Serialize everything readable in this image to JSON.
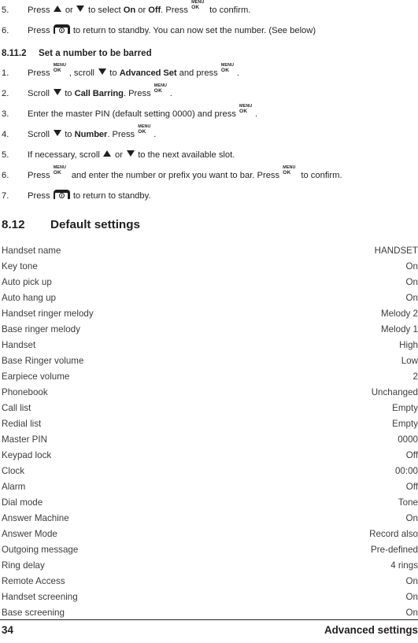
{
  "document": {
    "page_number": "34",
    "running_head": "Advanced settings"
  },
  "continued_steps": {
    "items": [
      {
        "num": "5.",
        "parts": [
          {
            "t": "text",
            "v": "Press "
          },
          {
            "t": "icon",
            "v": "triangle-up"
          },
          {
            "t": "text",
            "v": " or "
          },
          {
            "t": "icon",
            "v": "triangle-down"
          },
          {
            "t": "text",
            "v": " to select "
          },
          {
            "t": "emph",
            "v": "On"
          },
          {
            "t": "text",
            "v": " or "
          },
          {
            "t": "emph",
            "v": "Off"
          },
          {
            "t": "text",
            "v": ". Press "
          },
          {
            "t": "icon",
            "v": "menu-ok-key"
          },
          {
            "t": "text",
            "v": " to confirm."
          }
        ]
      },
      {
        "num": "6.",
        "parts": [
          {
            "t": "text",
            "v": "Press "
          },
          {
            "t": "icon",
            "v": "power-standby-key"
          },
          {
            "t": "text",
            "v": " to return to standby. You can now set the number. (See below)"
          }
        ]
      }
    ]
  },
  "section_8_11_2": {
    "number": "8.11.2",
    "title": "Set a number to be barred",
    "steps": [
      {
        "num": "1.",
        "parts": [
          {
            "t": "text",
            "v": "Press "
          },
          {
            "t": "icon",
            "v": "menu-ok-key"
          },
          {
            "t": "text",
            "v": ", scroll "
          },
          {
            "t": "icon",
            "v": "triangle-down"
          },
          {
            "t": "text",
            "v": " to "
          },
          {
            "t": "emph",
            "v": "Advanced Set"
          },
          {
            "t": "text",
            "v": " and press "
          },
          {
            "t": "icon",
            "v": "menu-ok-key"
          },
          {
            "t": "text",
            "v": "."
          }
        ]
      },
      {
        "num": "2.",
        "parts": [
          {
            "t": "text",
            "v": "Scroll "
          },
          {
            "t": "icon",
            "v": "triangle-down"
          },
          {
            "t": "text",
            "v": " to "
          },
          {
            "t": "emph",
            "v": "Call Barring"
          },
          {
            "t": "text",
            "v": ". Press "
          },
          {
            "t": "icon",
            "v": "menu-ok-key"
          },
          {
            "t": "text",
            "v": "."
          }
        ]
      },
      {
        "num": "3.",
        "parts": [
          {
            "t": "text",
            "v": "Enter the master PIN (default setting 0000) and press "
          },
          {
            "t": "icon",
            "v": "menu-ok-key"
          },
          {
            "t": "text",
            "v": "."
          }
        ]
      },
      {
        "num": "4.",
        "parts": [
          {
            "t": "text",
            "v": "Scroll "
          },
          {
            "t": "icon",
            "v": "triangle-down"
          },
          {
            "t": "text",
            "v": " to "
          },
          {
            "t": "emph",
            "v": "Number"
          },
          {
            "t": "text",
            "v": ". Press "
          },
          {
            "t": "icon",
            "v": "menu-ok-key"
          },
          {
            "t": "text",
            "v": "."
          }
        ]
      },
      {
        "num": "5.",
        "parts": [
          {
            "t": "text",
            "v": "If necessary, scroll "
          },
          {
            "t": "icon",
            "v": "triangle-up"
          },
          {
            "t": "text",
            "v": " or "
          },
          {
            "t": "icon",
            "v": "triangle-down"
          },
          {
            "t": "text",
            "v": " to the next available slot."
          }
        ]
      },
      {
        "num": "6.",
        "parts": [
          {
            "t": "text",
            "v": "Press "
          },
          {
            "t": "icon",
            "v": "menu-ok-key"
          },
          {
            "t": "text",
            "v": " and enter the number or prefix you want to bar. Press "
          },
          {
            "t": "icon",
            "v": "menu-ok-key"
          },
          {
            "t": "text",
            "v": " to confirm."
          }
        ]
      },
      {
        "num": "7.",
        "parts": [
          {
            "t": "text",
            "v": "Press "
          },
          {
            "t": "icon",
            "v": "power-standby-key"
          },
          {
            "t": "text",
            "v": " to return to standby."
          }
        ]
      }
    ]
  },
  "section_8_12": {
    "number": "8.12",
    "title": "Default settings",
    "rows": [
      {
        "label": "Handset name",
        "value": "HANDSET"
      },
      {
        "label": "Key tone",
        "value": "On"
      },
      {
        "label": "Auto pick up",
        "value": "On"
      },
      {
        "label": "Auto hang up",
        "value": "On"
      },
      {
        "label": "Handset ringer melody",
        "value": "Melody 2"
      },
      {
        "label": "Base ringer melody",
        "value": "Melody 1"
      },
      {
        "label": "Handset",
        "value": "High"
      },
      {
        "label": "Base Ringer volume",
        "value": "Low"
      },
      {
        "label": "Earpiece volume",
        "value": "2"
      },
      {
        "label": "Phonebook",
        "value": "Unchanged"
      },
      {
        "label": "Call list",
        "value": "Empty"
      },
      {
        "label": "Redial list",
        "value": "Empty"
      },
      {
        "label": "Master PIN",
        "value": "0000"
      },
      {
        "label": "Keypad lock",
        "value": "Off"
      },
      {
        "label": "Clock",
        "value": "00:00"
      },
      {
        "label": "Alarm",
        "value": "Off"
      },
      {
        "label": "Dial mode",
        "value": "Tone"
      },
      {
        "label": "Answer Machine",
        "value": "On"
      },
      {
        "label": "Answer Mode",
        "value": "Record also"
      },
      {
        "label": "Outgoing message",
        "value": "Pre-defined"
      },
      {
        "label": "Ring delay",
        "value": "4 rings"
      },
      {
        "label": "Remote Access",
        "value": "On"
      },
      {
        "label": "Handset screening",
        "value": "On"
      },
      {
        "label": "Base screening",
        "value": "On"
      }
    ]
  },
  "colors": {
    "ink": "#231f20",
    "table_text": "#3c3c3c",
    "paper": "#ffffff"
  }
}
